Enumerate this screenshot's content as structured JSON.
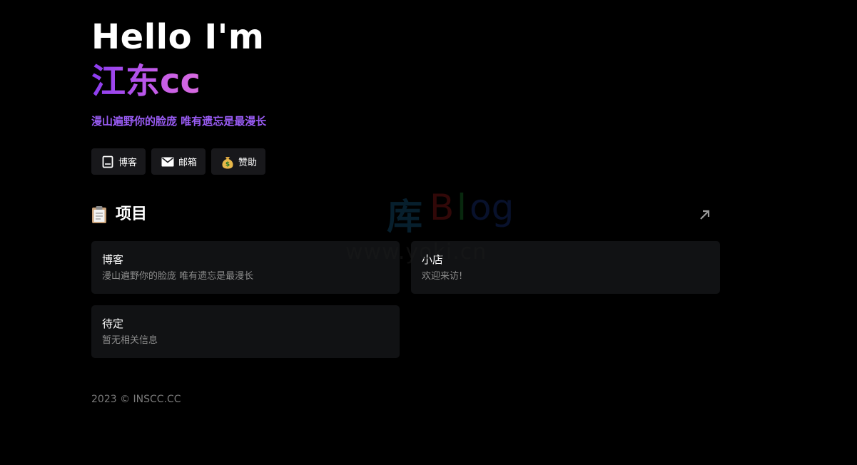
{
  "hero": {
    "greeting": "Hello I'm",
    "name": "江东cc",
    "tagline": "漫山遍野你的脸庞 唯有遗忘是最漫长"
  },
  "buttons": [
    {
      "label": "博客",
      "icon": "book-icon"
    },
    {
      "label": "邮箱",
      "icon": "mail-icon"
    },
    {
      "label": "赞助",
      "icon": "money-bag-icon"
    }
  ],
  "projects": {
    "title": "项目",
    "icon": "clipboard-icon",
    "link_icon": "arrow-up-right-icon",
    "items": [
      {
        "title": "博客",
        "description": "漫山遍野你的脸庞 唯有遗忘是最漫长"
      },
      {
        "title": "小店",
        "description": "欢迎来访!"
      },
      {
        "title": "待定",
        "description": "暂无相关信息"
      }
    ]
  },
  "footer": {
    "text": "2023 © INSCC.CC"
  },
  "watermark": {
    "ku": "库",
    "blog_b": "B",
    "blog_l": "l",
    "blog_og": "og",
    "url": "www.yoki.cn"
  },
  "colors": {
    "background": "#000000",
    "accent": "#9a5cf5",
    "card": "#111214",
    "button": "#18181b"
  }
}
